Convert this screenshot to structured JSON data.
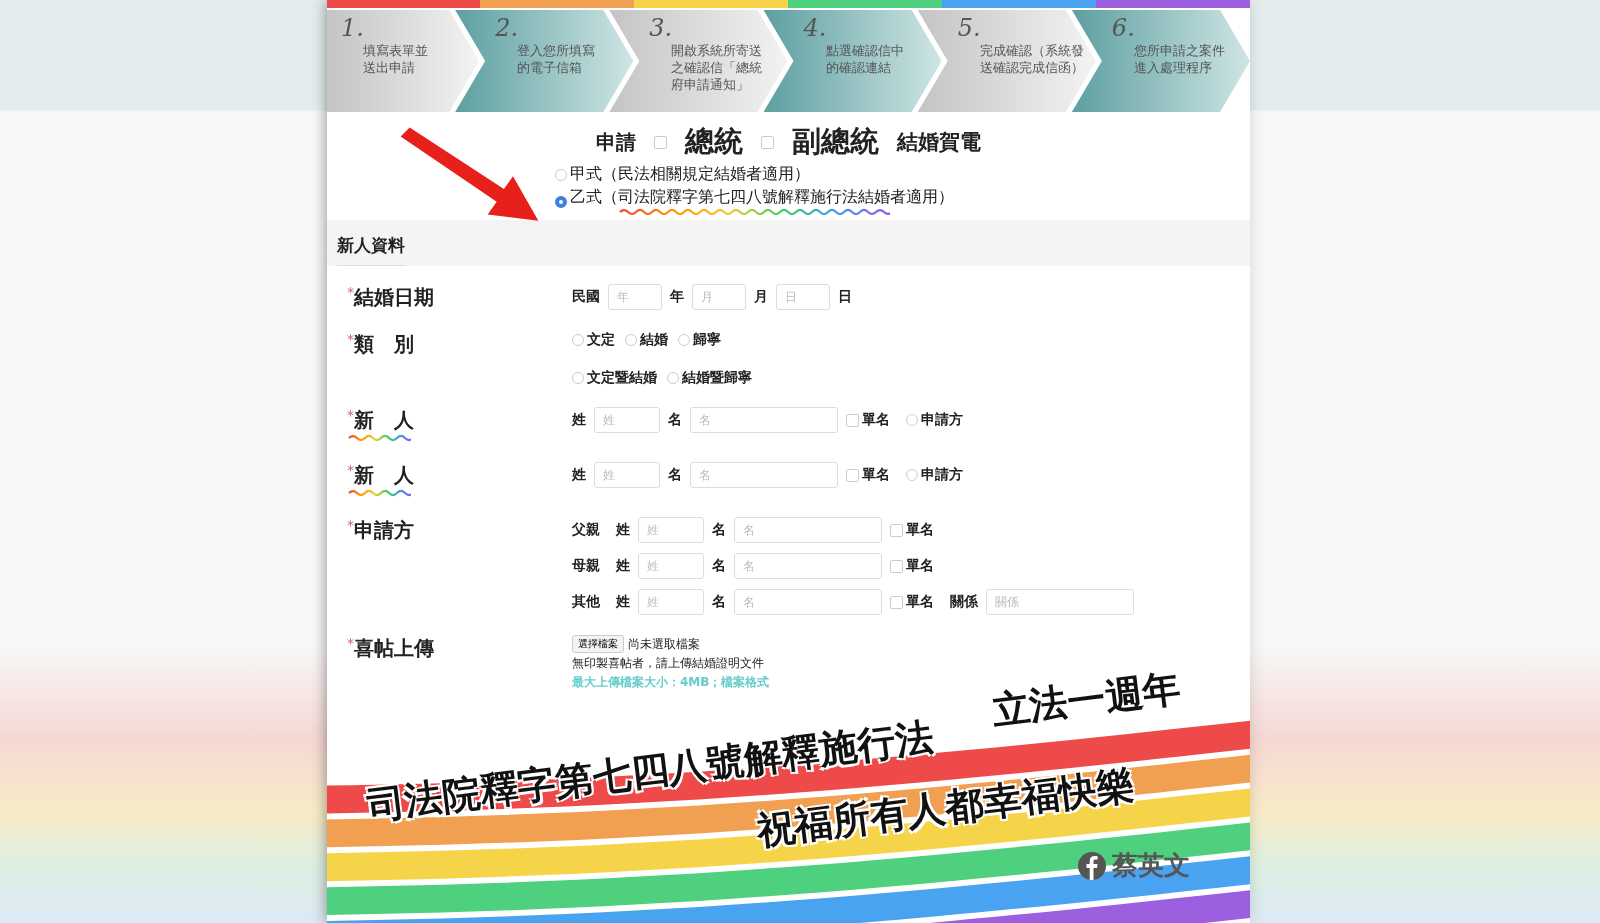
{
  "steps": [
    {
      "number": "1.",
      "lines": [
        "填寫表單並",
        "送出申請"
      ]
    },
    {
      "number": "2.",
      "lines": [
        "登入您所填寫",
        "的電子信箱"
      ]
    },
    {
      "number": "3.",
      "lines": [
        "開啟系統所寄送",
        "之確認信「總統",
        "府申請通知」"
      ]
    },
    {
      "number": "4.",
      "lines": [
        "點選確認信中",
        "的確認連結"
      ]
    },
    {
      "number": "5.",
      "lines": [
        "完成確認（系統發",
        "送確認完成信函）"
      ]
    },
    {
      "number": "6.",
      "lines": [
        "您所申請之案件",
        "進入處理程序"
      ]
    }
  ],
  "title": {
    "prefix": "申請",
    "options": [
      {
        "label": "總統",
        "checked": false
      },
      {
        "label": "副總統",
        "checked": false
      }
    ],
    "suffix": "結婚賀電"
  },
  "form_types": [
    {
      "label": "甲式（民法相關規定結婚者適用）",
      "selected": false,
      "wavy_underline": false
    },
    {
      "label": "乙式（司法院釋字第七四八號解釋施行法結婚者適用）",
      "selected": true,
      "wavy_underline": true
    }
  ],
  "section": "新人資料",
  "fields": [
    {
      "kind": "date",
      "mark": "*",
      "label": "結婚日期",
      "era": "民國",
      "inputs": [
        {
          "placeholder": "年",
          "unit": "年"
        },
        {
          "placeholder": "月",
          "unit": "月"
        },
        {
          "placeholder": "日",
          "unit": "日"
        }
      ]
    },
    {
      "kind": "radios",
      "mark": "*",
      "label": "類　別",
      "options": [
        [
          {
            "label": "文定",
            "selected": false
          },
          {
            "label": "結婚",
            "selected": false
          },
          {
            "label": "歸寧",
            "selected": false
          }
        ],
        [
          {
            "label": "文定暨結婚",
            "selected": false
          },
          {
            "label": "結婚暨歸寧",
            "selected": false
          }
        ]
      ]
    },
    {
      "kind": "name",
      "mark": "*",
      "label": "新　人",
      "wavy_underline": true,
      "surname_label": "姓",
      "surname_placeholder": "姓",
      "given_label": "名",
      "given_placeholder": "名",
      "single_name": {
        "label": "單名",
        "checked": false
      },
      "applicant": {
        "label": "申請方",
        "selected": false
      }
    },
    {
      "kind": "name",
      "mark": "*",
      "label": "新　人",
      "wavy_underline": true,
      "surname_label": "姓",
      "surname_placeholder": "姓",
      "given_label": "名",
      "given_placeholder": "名",
      "single_name": {
        "label": "單名",
        "checked": false
      },
      "applicant": {
        "label": "申請方",
        "selected": false
      }
    },
    {
      "kind": "applicant",
      "mark": "*",
      "label": "申請方",
      "rows": [
        {
          "relation": "父親",
          "surname_label": "姓",
          "surname_placeholder": "姓",
          "given_label": "名",
          "given_placeholder": "名",
          "single_name": {
            "label": "單名",
            "checked": false
          }
        },
        {
          "relation": "母親",
          "surname_label": "姓",
          "surname_placeholder": "姓",
          "given_label": "名",
          "given_placeholder": "名",
          "single_name": {
            "label": "單名",
            "checked": false
          }
        },
        {
          "relation": "其他",
          "surname_label": "姓",
          "surname_placeholder": "姓",
          "given_label": "名",
          "given_placeholder": "名",
          "single_name": {
            "label": "單名",
            "checked": false
          },
          "relationship_label": "關係",
          "relationship_placeholder": "關係"
        }
      ]
    },
    {
      "kind": "upload",
      "mark": "*",
      "label": "喜帖上傳",
      "button": "選擇檔案",
      "status": "尚未選取檔案",
      "note": "無印製喜帖者，請上傳結婚證明文件",
      "limit": "最大上傳檔案大小：4MB；檔案格式"
    }
  ],
  "banner": {
    "line_1": "司法院釋字第七四八號解釋施行法",
    "line_2": "立法一週年",
    "line_3": "祝福所有人都幸福快樂",
    "author": "蔡英文"
  }
}
